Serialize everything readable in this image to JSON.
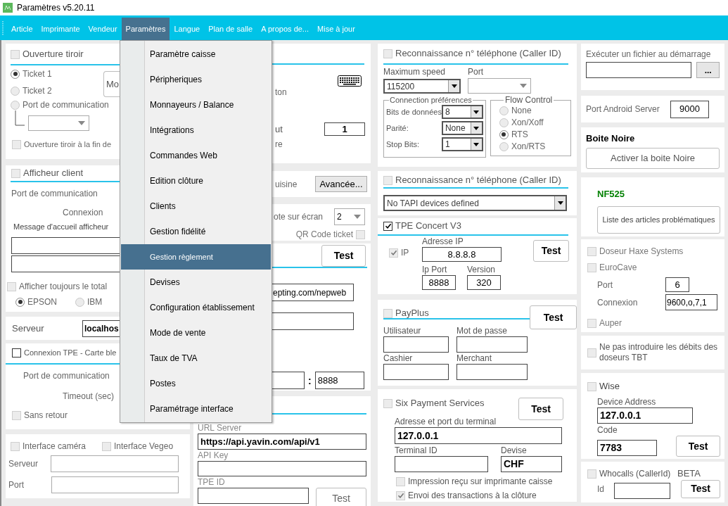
{
  "window": {
    "title": "Paramètres v5.20.11"
  },
  "menu_bar": [
    {
      "label": "Article",
      "selected": false
    },
    {
      "label": "Imprimante",
      "selected": false
    },
    {
      "label": "Vendeur",
      "selected": false
    },
    {
      "label": "Paramètres",
      "selected": true
    },
    {
      "label": "Langue",
      "selected": false
    },
    {
      "label": "Plan de salle",
      "selected": false
    },
    {
      "label": "A propos de...",
      "selected": false
    },
    {
      "label": "Mise à jour",
      "selected": false
    }
  ],
  "dropdown": [
    {
      "label": "Paramètre caisse",
      "selected": false
    },
    {
      "label": "Péripheriques",
      "selected": false
    },
    {
      "label": "Monnayeurs / Balance",
      "selected": false
    },
    {
      "label": "Intégrations",
      "selected": false
    },
    {
      "label": "Commandes Web",
      "selected": false
    },
    {
      "label": "Edition clôture",
      "selected": false
    },
    {
      "label": "Clients",
      "selected": false
    },
    {
      "label": "Gestion fidélité",
      "selected": false
    },
    {
      "label": "Gestion règlement",
      "selected": true
    },
    {
      "label": "Devises",
      "selected": false
    },
    {
      "label": "Configuration établissement",
      "selected": false
    },
    {
      "label": "Mode de vente",
      "selected": false
    },
    {
      "label": "Taux de TVA",
      "selected": false
    },
    {
      "label": "Postes",
      "selected": false
    },
    {
      "label": "Paramétrage interface",
      "selected": false
    }
  ],
  "drawer": {
    "title": "Ouverture tiroir",
    "checked": false,
    "options": [
      {
        "label": "Ticket 1",
        "selected": true
      },
      {
        "label": "Ticket 2",
        "selected": false
      },
      {
        "label": "Port de communication",
        "selected": false
      }
    ],
    "side_button": "Mo",
    "end_of": {
      "label": "Ouverture tiroir à la fin de",
      "checked": false
    }
  },
  "customer_display": {
    "title": "Afficheur client",
    "checked": false,
    "port_label": "Port de communication",
    "connection_label": "Connexion",
    "message_label": "Message d'accueil afficheur",
    "always_total": {
      "label": "Afficher toujours le total",
      "checked": false
    },
    "printers": [
      {
        "label": "EPSON",
        "selected": true
      },
      {
        "label": "IBM",
        "selected": false
      }
    ]
  },
  "server": {
    "label": "Serveur",
    "value": "localhos"
  },
  "card_terminal": {
    "title": "Connexion TPE - Carte ble",
    "checked": false,
    "port_label": "Port de communication",
    "timeout_label": "Timeout (sec)",
    "no_return": {
      "label": "Sans retour",
      "checked": false
    }
  },
  "camera": {
    "options": [
      {
        "label": "Interface caméra",
        "checked": false
      },
      {
        "label": "Interface Vegeo",
        "checked": false
      }
    ],
    "server_label": "Serveur",
    "port_label": "Port"
  },
  "display_panel": {
    "labels": [
      "ton",
      "ut",
      "re"
    ],
    "value": "1"
  },
  "kitchen": {
    "label": "uisine",
    "button": "Avancée..."
  },
  "screen": {
    "label": "ote sur écran",
    "value": "2",
    "qr_code": {
      "label": "QR Code ticket",
      "checked": false
    }
  },
  "payment_terminal": {
    "test_button": "Test",
    "url": "epting.com/nepweb",
    "port_separator": ":",
    "port": "8888"
  },
  "yavin": {
    "url_label": "URL Server",
    "url": "https://api.yavin.com/api/v1",
    "api_key_label": "API Key",
    "tpe_id_label": "TPE ID",
    "test_button": "Test"
  },
  "caller_id": {
    "title": "Reconnaissance n° téléphone (Caller ID)",
    "checked": false,
    "speed_label": "Maximum speed",
    "speed": "115200",
    "port_label": "Port",
    "prefs_title": "Connection préférences",
    "prefs": [
      {
        "label": "Bits de données",
        "value": "8"
      },
      {
        "label": "Parité:",
        "value": "None"
      },
      {
        "label": "Stop Bits:",
        "value": "1"
      }
    ],
    "flow_title": "Flow Control",
    "flow": [
      {
        "label": "None",
        "selected": false
      },
      {
        "label": "Xon/Xoff",
        "selected": false
      },
      {
        "label": "RTS",
        "selected": true
      },
      {
        "label": "Xon/RTS",
        "selected": false
      }
    ]
  },
  "caller_id_tapi": {
    "title": "Reconnaissance n° téléphone (Caller ID)",
    "checked": false,
    "device": "No TAPI devices defined"
  },
  "concert": {
    "title": "TPE Concert V3",
    "checked": true,
    "ip": {
      "label": "IP",
      "checked": true
    },
    "ip_label": "Adresse IP",
    "ip_value": "8.8.8.8",
    "port_label": "Ip Port",
    "port": "8888",
    "version_label": "Version",
    "version": "320",
    "test_button": "Test"
  },
  "payplus": {
    "title": "PayPlus",
    "checked": false,
    "test_button": "Test",
    "field_labels": [
      "Utilisateur",
      "Mot de passe",
      "Cashier",
      "Merchant"
    ]
  },
  "six": {
    "title": "Six Payment Services",
    "checked": false,
    "test_button": "Test",
    "address_label": "Adresse et port du terminal",
    "address": "127.0.0.1",
    "terminal_label": "Terminal ID",
    "currency_label": "Devise",
    "currency": "CHF",
    "options": [
      {
        "label": "Impression reçu sur imprimante caisse",
        "checked": false
      },
      {
        "label": "Envoi des transactions à la clôture",
        "checked": true
      }
    ]
  },
  "startup": {
    "label": "Exécuter un fichier au démarrage",
    "browse_button": "..."
  },
  "android": {
    "label": "Port Android Server",
    "value": "9000"
  },
  "black_box": {
    "title": "Boite Noire",
    "button": "Activer la boite Noire"
  },
  "nf525": {
    "title": "NF525",
    "button": "Liste des articles problématiques"
  },
  "dosers": {
    "haxe": {
      "label": "Doseur Haxe Systems",
      "checked": false
    },
    "eurocave": {
      "label": "EuroCave",
      "checked": false
    },
    "port_label": "Port",
    "port": "6",
    "connection_label": "Connexion",
    "connection": "9600,o,7,1",
    "auper": {
      "label": "Auper",
      "checked": false
    }
  },
  "tbt": {
    "label": "Ne pas introduire les débits des doseurs TBT",
    "checked": false
  },
  "wise": {
    "title": "Wise",
    "checked": false,
    "address_label": "Device Address",
    "address": "127.0.0.1",
    "code_label": "Code",
    "code": "7783",
    "test_button": "Test"
  },
  "whocalls": {
    "title": "Whocalls (CallerId)",
    "checked": false,
    "badge": "BETA",
    "id_label": "Id",
    "test_button": "Test"
  }
}
